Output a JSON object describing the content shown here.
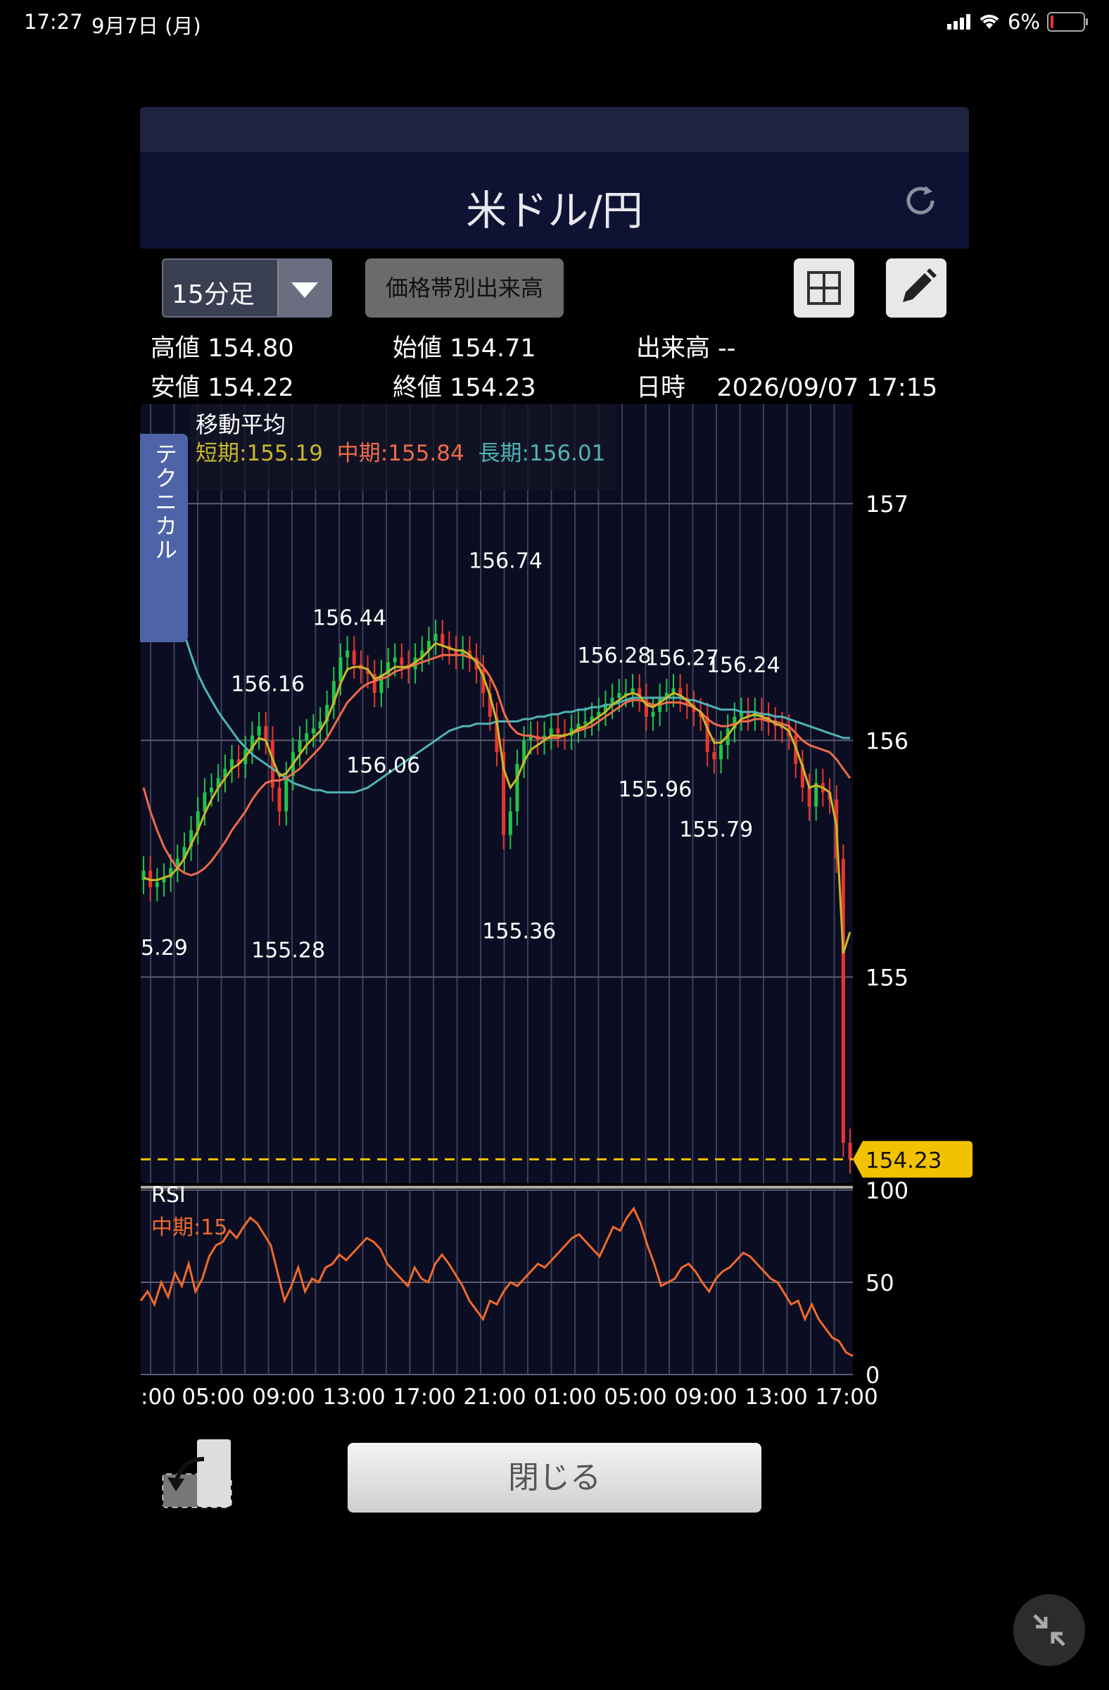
{
  "status_bar": {
    "time": "17:27",
    "date": "9月7日 (月)",
    "battery": "6%"
  },
  "header": {
    "title": "米ドル/円"
  },
  "toolbar": {
    "timeframe": "15分足",
    "volume_profile_label": "価格帯別出来高"
  },
  "ohlc": {
    "high_label": "高値",
    "high": "154.80",
    "open_label": "始値",
    "open": "154.71",
    "volume_label": "出来高",
    "volume": "--",
    "low_label": "安値",
    "low": "154.22",
    "close_label": "終値",
    "close": "154.23",
    "datetime_label": "日時",
    "datetime": "2026/09/07 17:15"
  },
  "technical_tab": "テクニカル",
  "moving_average": {
    "title": "移動平均",
    "short": "短期:155.19",
    "mid": "中期:155.84",
    "long": "長期:156.01"
  },
  "rsi": {
    "label": "RSI",
    "mid": "中期:15"
  },
  "current_price": "154.23",
  "close_button": "閉じる",
  "colors": {
    "up": "#21c44a",
    "down": "#e8362e",
    "short_ma": "#c8b82a",
    "mid_ma": "#ef6a4a",
    "long_ma": "#4fb3b5",
    "rsi": "#ef6a2a",
    "price_tag": "#f2c200"
  },
  "chart_data": {
    "type": "candlestick",
    "price_axis": {
      "ticks": [
        157,
        156,
        155
      ],
      "ylim": [
        154.13,
        157.42
      ]
    },
    "rsi_axis": {
      "ticks": [
        100,
        50,
        0
      ],
      "ylim": [
        0,
        100
      ]
    },
    "x_tick_labels": [
      ":00",
      "05:00",
      "09:00",
      "13:00",
      "17:00",
      "21:00",
      "01:00",
      "05:00",
      "09:00",
      "13:00",
      "17:00"
    ],
    "annotations": [
      {
        "label": "156.74",
        "x_index": 52,
        "value": 156.74
      },
      {
        "label": "156.44",
        "x_index": 29,
        "value": 156.44
      },
      {
        "label": "156.16",
        "x_index": 17,
        "value": 156.16
      },
      {
        "label": "156.06",
        "x_index": 34,
        "value": 156.06
      },
      {
        "label": "5.29",
        "x_index": 0,
        "value": 155.29
      },
      {
        "label": "155.28",
        "x_index": 20,
        "value": 155.28
      },
      {
        "label": "155.36",
        "x_index": 54,
        "value": 155.36
      },
      {
        "label": "156.28",
        "x_index": 68,
        "value": 156.28
      },
      {
        "label": "156.27",
        "x_index": 78,
        "value": 156.27
      },
      {
        "label": "156.24",
        "x_index": 87,
        "value": 156.24
      },
      {
        "label": "155.96",
        "x_index": 74,
        "value": 155.96
      },
      {
        "label": "155.79",
        "x_index": 83,
        "value": 155.79
      }
    ],
    "closes": [
      155.45,
      155.38,
      155.4,
      155.42,
      155.46,
      155.5,
      155.55,
      155.62,
      155.7,
      155.78,
      155.8,
      155.84,
      155.88,
      155.92,
      155.9,
      155.96,
      156.02,
      156.06,
      156.0,
      155.8,
      155.7,
      155.85,
      155.95,
      156.0,
      156.03,
      156.05,
      156.08,
      156.15,
      156.25,
      156.35,
      156.38,
      156.32,
      156.3,
      156.28,
      156.2,
      156.28,
      156.33,
      156.35,
      156.32,
      156.3,
      156.35,
      156.38,
      156.42,
      156.45,
      156.4,
      156.38,
      156.36,
      156.38,
      156.35,
      156.3,
      156.2,
      156.1,
      155.95,
      155.6,
      155.7,
      155.9,
      156.0,
      156.02,
      156.0,
      156.02,
      156.05,
      156.03,
      156.02,
      156.05,
      156.07,
      156.08,
      156.1,
      156.12,
      156.15,
      156.18,
      156.2,
      156.2,
      156.22,
      156.18,
      156.1,
      156.12,
      156.18,
      156.2,
      156.22,
      156.18,
      156.15,
      156.12,
      156.1,
      155.95,
      155.92,
      155.98,
      156.05,
      156.1,
      156.12,
      156.1,
      156.12,
      156.1,
      156.08,
      156.06,
      156.05,
      156.02,
      155.9,
      155.8,
      155.72,
      155.82,
      155.78,
      155.75,
      155.5,
      154.3,
      154.23
    ],
    "short_ma": [
      155.42,
      155.41,
      155.41,
      155.42,
      155.43,
      155.46,
      155.5,
      155.56,
      155.62,
      155.69,
      155.75,
      155.8,
      155.84,
      155.88,
      155.9,
      155.93,
      155.97,
      156.01,
      156.0,
      155.92,
      155.85,
      155.86,
      155.9,
      155.94,
      155.98,
      156.01,
      156.04,
      156.09,
      156.16,
      156.24,
      156.3,
      156.31,
      156.31,
      156.3,
      156.26,
      156.27,
      156.29,
      156.31,
      156.31,
      156.31,
      156.33,
      156.35,
      156.38,
      156.41,
      156.4,
      156.39,
      156.38,
      156.38,
      156.36,
      156.33,
      156.27,
      156.19,
      156.08,
      155.88,
      155.8,
      155.84,
      155.91,
      155.96,
      155.98,
      156.0,
      156.02,
      156.02,
      156.02,
      156.03,
      156.05,
      156.06,
      156.08,
      156.1,
      156.12,
      156.15,
      156.17,
      156.19,
      156.2,
      156.19,
      156.15,
      156.14,
      156.16,
      156.18,
      156.2,
      156.19,
      156.17,
      156.14,
      156.12,
      156.05,
      155.99,
      155.99,
      156.02,
      156.06,
      156.09,
      156.1,
      156.11,
      156.1,
      156.09,
      156.07,
      156.06,
      156.04,
      155.97,
      155.89,
      155.8,
      155.81,
      155.8,
      155.78,
      155.64,
      155.1,
      155.19
    ],
    "mid_ma": [
      155.8,
      155.7,
      155.62,
      155.55,
      155.5,
      155.46,
      155.44,
      155.43,
      155.44,
      155.46,
      155.49,
      155.53,
      155.57,
      155.62,
      155.66,
      155.7,
      155.75,
      155.79,
      155.82,
      155.83,
      155.83,
      155.84,
      155.86,
      155.88,
      155.91,
      155.94,
      155.97,
      156.01,
      156.06,
      156.11,
      156.16,
      156.19,
      156.22,
      156.24,
      156.25,
      156.26,
      156.27,
      156.29,
      156.3,
      156.31,
      156.32,
      156.33,
      156.34,
      156.35,
      156.36,
      156.36,
      156.36,
      156.36,
      156.35,
      156.34,
      156.31,
      156.27,
      156.21,
      156.12,
      156.06,
      156.03,
      156.02,
      156.02,
      156.01,
      156.01,
      156.01,
      156.01,
      156.02,
      156.03,
      156.04,
      156.05,
      156.06,
      156.08,
      156.1,
      156.12,
      156.14,
      156.16,
      156.17,
      156.17,
      156.16,
      156.15,
      156.15,
      156.16,
      156.16,
      156.16,
      156.15,
      156.14,
      156.12,
      156.09,
      156.07,
      156.06,
      156.06,
      156.07,
      156.08,
      156.08,
      156.09,
      156.09,
      156.08,
      156.08,
      156.07,
      156.06,
      156.03,
      156.0,
      155.98,
      155.97,
      155.96,
      155.95,
      155.92,
      155.88,
      155.84
    ],
    "long_ma": [
      157.18,
      157.05,
      156.92,
      156.8,
      156.68,
      156.56,
      156.45,
      156.36,
      156.28,
      156.22,
      156.17,
      156.12,
      156.08,
      156.04,
      156.0,
      155.97,
      155.94,
      155.92,
      155.9,
      155.88,
      155.86,
      155.84,
      155.82,
      155.81,
      155.8,
      155.79,
      155.79,
      155.78,
      155.78,
      155.78,
      155.78,
      155.78,
      155.79,
      155.8,
      155.82,
      155.84,
      155.86,
      155.88,
      155.9,
      155.92,
      155.94,
      155.96,
      155.98,
      156.0,
      156.02,
      156.04,
      156.05,
      156.06,
      156.06,
      156.07,
      156.07,
      156.07,
      156.08,
      156.08,
      156.08,
      156.08,
      156.09,
      156.09,
      156.1,
      156.1,
      156.11,
      156.11,
      156.12,
      156.12,
      156.13,
      156.13,
      156.14,
      156.14,
      156.15,
      156.15,
      156.16,
      156.17,
      156.18,
      156.18,
      156.18,
      156.18,
      156.18,
      156.18,
      156.18,
      156.18,
      156.17,
      156.17,
      156.16,
      156.15,
      156.14,
      156.13,
      156.13,
      156.13,
      156.12,
      156.12,
      156.12,
      156.11,
      156.11,
      156.1,
      156.1,
      156.09,
      156.08,
      156.07,
      156.06,
      156.05,
      156.04,
      156.03,
      156.02,
      156.01,
      156.01
    ],
    "rsi": [
      40,
      45,
      38,
      50,
      42,
      55,
      48,
      60,
      45,
      52,
      64,
      70,
      72,
      78,
      74,
      80,
      85,
      82,
      76,
      70,
      55,
      40,
      48,
      58,
      45,
      52,
      50,
      58,
      60,
      65,
      62,
      66,
      70,
      74,
      72,
      68,
      60,
      56,
      52,
      48,
      58,
      52,
      50,
      60,
      65,
      60,
      54,
      48,
      40,
      35,
      30,
      40,
      38,
      45,
      50,
      48,
      52,
      56,
      60,
      58,
      62,
      66,
      70,
      74,
      76,
      72,
      68,
      64,
      72,
      80,
      78,
      85,
      90,
      82,
      70,
      60,
      48,
      50,
      52,
      58,
      60,
      56,
      50,
      45,
      52,
      56,
      58,
      62,
      66,
      64,
      60,
      56,
      52,
      50,
      44,
      38,
      40,
      30,
      38,
      30,
      25,
      20,
      18,
      12,
      10
    ]
  }
}
